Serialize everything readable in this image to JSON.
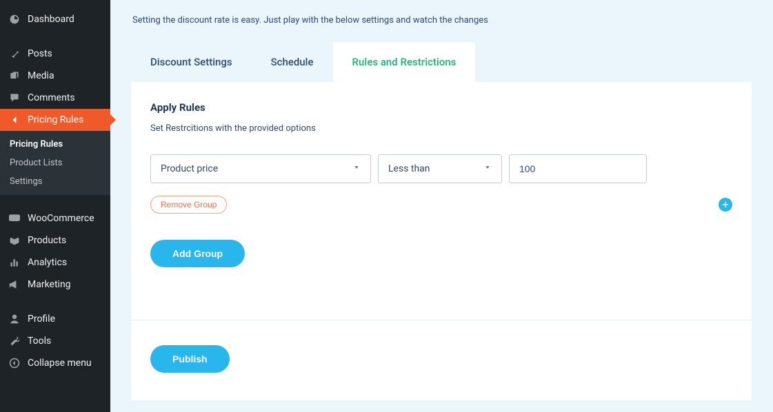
{
  "sidebar": {
    "top": [
      {
        "label": "Dashboard",
        "icon": "dashboard"
      },
      {
        "label": "Posts",
        "icon": "pin"
      },
      {
        "label": "Media",
        "icon": "media"
      },
      {
        "label": "Comments",
        "icon": "comment"
      },
      {
        "label": "Pricing Rules",
        "icon": "back",
        "active": true
      }
    ],
    "sub": [
      {
        "label": "Pricing Rules",
        "current": true
      },
      {
        "label": "Product Lists"
      },
      {
        "label": "Settings"
      }
    ],
    "bottom": [
      {
        "label": "WooCommerce",
        "icon": "woo"
      },
      {
        "label": "Products",
        "icon": "box"
      },
      {
        "label": "Analytics",
        "icon": "bars"
      },
      {
        "label": "Marketing",
        "icon": "mega"
      },
      {
        "label": "Profile",
        "icon": "user"
      },
      {
        "label": "Tools",
        "icon": "wrench"
      },
      {
        "label": "Collapse menu",
        "icon": "collapse"
      }
    ]
  },
  "intro": "Setting the discount rate is easy. Just play with the below settings and watch the changes",
  "tabs": [
    {
      "label": "Discount Settings"
    },
    {
      "label": "Schedule"
    },
    {
      "label": "Rules and Restrictions",
      "active": true
    }
  ],
  "section": {
    "heading": "Apply Rules",
    "desc": "Set Restrcitions with the provided options"
  },
  "rule": {
    "field": "Product price",
    "operator": "Less than",
    "value": "100"
  },
  "buttons": {
    "removeGroup": "Remove Group",
    "addGroup": "Add Group",
    "publish": "Publish"
  }
}
